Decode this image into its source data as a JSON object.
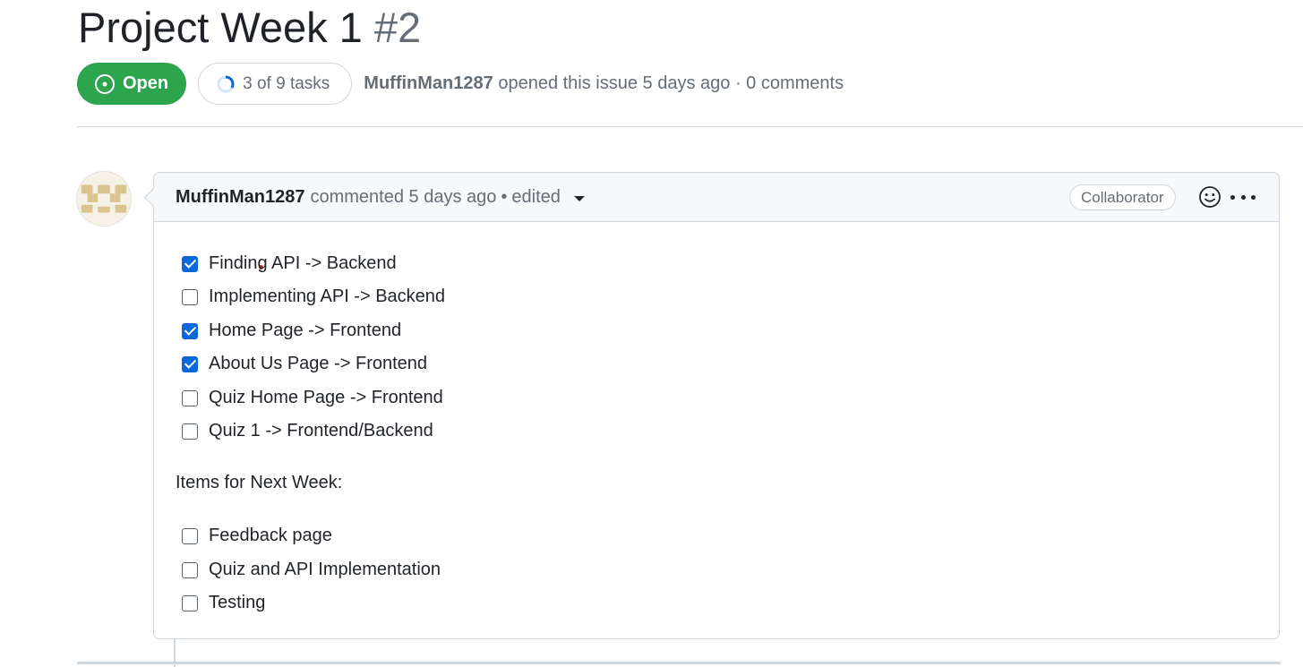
{
  "issue": {
    "title": "Project Week 1",
    "number": "#2",
    "state": "Open",
    "tasks_progress": "3 of 9 tasks",
    "tasks_fraction": 0.333,
    "author": "MuffinMan1287",
    "opened_text": "opened this issue 5 days ago · 0 comments"
  },
  "comment": {
    "author": "MuffinMan1287",
    "meta": "commented 5 days ago",
    "edited": "edited",
    "role": "Collaborator",
    "react_icon": "smiley-icon",
    "more_icon": "kebab-horizontal-icon",
    "tasks": [
      {
        "label": "Finding API -> Backend",
        "checked": true
      },
      {
        "label": "Implementing API -> Backend",
        "checked": false
      },
      {
        "label": "Home Page -> Frontend",
        "checked": true
      },
      {
        "label": "About Us Page -> Frontend",
        "checked": true
      },
      {
        "label": "Quiz Home Page -> Frontend",
        "checked": false
      },
      {
        "label": "Quiz 1 -> Frontend/Backend",
        "checked": false
      }
    ],
    "next_week_heading": "Items for Next Week:",
    "next_week_tasks": [
      {
        "label": "Feedback page",
        "checked": false
      },
      {
        "label": "Quiz and API Implementation",
        "checked": false
      },
      {
        "label": "Testing",
        "checked": false
      }
    ]
  },
  "colors": {
    "open_green": "#2da44e",
    "checkbox_blue": "#0969da",
    "muted_text": "#656d76",
    "border": "#d0d7de"
  }
}
